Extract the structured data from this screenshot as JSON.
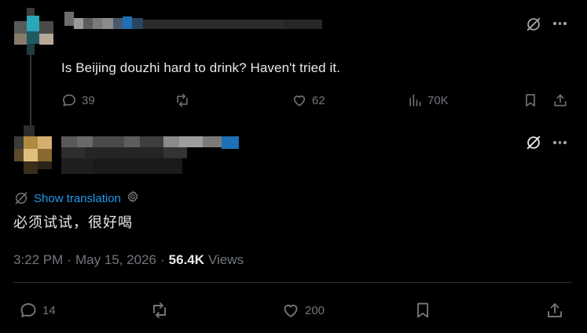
{
  "reply_tweet": {
    "text": "Is Beijing douzhi hard to drink? Haven't tried it.",
    "replies": "39",
    "retweets": "",
    "likes": "62",
    "views": "70K"
  },
  "main_tweet": {
    "show_translation_label": "Show translation",
    "text": "必须试试，很好喝",
    "time": "3:22 PM",
    "separator": "·",
    "date": "May 15, 2026",
    "views_count": "56.4K",
    "views_label": "Views",
    "replies": "14",
    "retweets": "",
    "likes": "200"
  },
  "colors": {
    "background": "#000000",
    "text": "#e7e9ea",
    "muted": "#71767b",
    "link": "#1d9bf0",
    "divider": "#2f3336"
  },
  "icons": [
    "grok-icon",
    "more-icon",
    "reply-icon",
    "retweet-icon",
    "like-icon",
    "views-icon",
    "bookmark-icon",
    "share-icon",
    "translate-icon",
    "gear-icon"
  ]
}
